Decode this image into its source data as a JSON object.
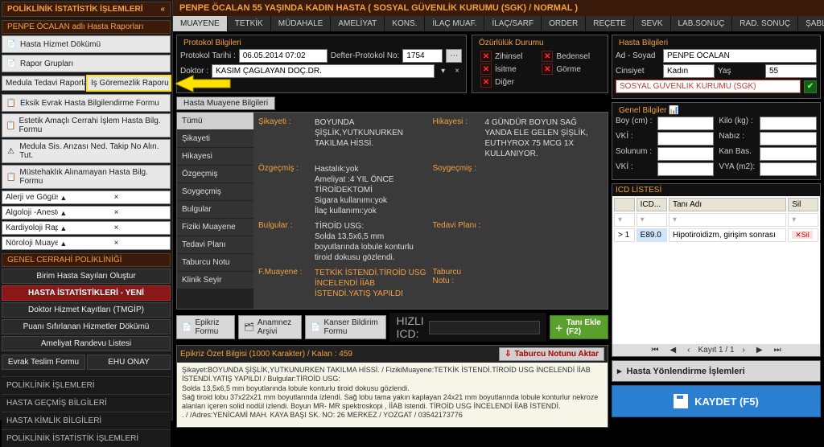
{
  "left": {
    "title": "POLİKLİNİK İSTATİSTİK İŞLEMLERİ",
    "collapse": "«",
    "section1": "PENPE ÖCALAN adlı Hasta Raporları",
    "btn_hasta_hizmet": "Hasta Hizmet Dökümü",
    "btn_rapor_gruplari": "Rapor Grupları",
    "btn_medula": "Medula Tedavi Raporları",
    "btn_is_goremezlik": "Iş Göremezlik Raporu",
    "btn_eksik_evrak": "Eksik Evrak Hasta Bilgilendirme Formu",
    "btn_estetik": "Estetik Amaçlı Cerrahi İşlem Hasta Bilg. Formu",
    "btn_medula_ariza": "Medula Sis. Arızası Ned. Takip No Alın. Tut.",
    "btn_mustehak": "Müstehaklık Alınamayan Hasta Bilg. Formu",
    "combo1": "Alerji ve Gögüs Hastalıkları (Prick) Testleri",
    "combo2": "Algoloji -Anestezi Polikliniği Formları",
    "combo3": "Kardiyoloji Raporları",
    "combo4": "Nöroloji Muayene Testleri",
    "section2": "GENEL CERRAHİ POLİKLİNİĞİ",
    "btn_birim": "Birim Hasta Sayıları Oluştur",
    "btn_istat": "HASTA İSTATİSTİKLERİ - YENİ",
    "btn_doktor": "Doktor Hizmet Kayıtları (TMGİP)",
    "btn_puanisifir": "Puanı Sıfırlanan Hizmetler Dökümü",
    "btn_ameliyat": "Ameliyat Randevu Listesi",
    "btn_evrak": "Evrak Teslim Formu",
    "btn_ehu": "EHU ONAY",
    "nav1": "POLİKLİNİK İŞLEMLERİ",
    "nav2": "HASTA GEÇMİŞ BİLGİLERİ",
    "nav3": "HASTA KİMLİK BİLGİLERİ",
    "nav4": "POLİKLİNİK İSTATİSTİK İŞLEMLERİ"
  },
  "top": {
    "banner": "PENPE ÖCALAN 55 YAŞINDA KADIN HASTA ( SOSYAL GÜVENLİK KURUMU (SGK) / NORMAL )",
    "tabs": [
      "MUAYENE",
      "TETKİK",
      "MÜDAHALE",
      "AMELİYAT",
      "KONS.",
      "İLAÇ MUAF.",
      "İLAÇ/SARF",
      "ORDER",
      "REÇETE",
      "SEVK",
      "LAB.SONUÇ",
      "RAD. SONUÇ",
      "ŞABLON"
    ]
  },
  "protokol": {
    "title": "Protokol Bilgileri",
    "tarih_label": "Protokol Tarihi :",
    "tarih": "06.05.2014 07:02",
    "defter_label": "Defter-Protokol No:",
    "defter": "1754",
    "doktor_label": "Doktor :",
    "doktor": "KASIM ÇAĞLAYAN DOÇ.DR."
  },
  "ozurluluk": {
    "title": "Özürlülük Durumu",
    "items": [
      "Zihinsel",
      "Bedensel",
      "İsitme",
      "Görme",
      "Diğer"
    ]
  },
  "hasta": {
    "title": "Hasta Bilgileri",
    "ad_label": "Ad - Soyad",
    "ad": "PENPE ÖCALAN",
    "cins_label": "Cinsiyet",
    "cins": "Kadın",
    "yas_label": "Yaş",
    "yas": "55",
    "kurum": "SOSYAL GÜVENLİK KURUMU (SGK)"
  },
  "muayene": {
    "title": "Hasta Muayene Bilgileri",
    "tabs": [
      "Tümü",
      "Şikayeti",
      "Hikayesi",
      "Özgeçmiş",
      "Soygeçmiş",
      "Bulgular",
      "Fiziki Muayene",
      "Tedavi Planı",
      "Taburcu Notu",
      "Klinik Seyir"
    ],
    "l_sikayeti": "Şikayeti :",
    "v_sikayeti": "BOYUNDA ŞİŞLİK,YUTKUNURKEN TAKILMA HİSSİ.",
    "l_hikayesi": "Hikayesi :",
    "v_hikayesi": "4 GÜNDÜR BOYUN SAĞ YANDA ELE GELEN ŞİŞLİK, EUTHYROX 75 MCG 1X KULLANIYOR.",
    "l_ozgecmis": "Özgeçmiş :",
    "v_ozgecmis": "Hastalık:yok\nAmeliyat :4 YIL ÖNCE TİROİDEKTOMİ\nSigara kullanımı:yok\nİlaç kullanımı:yok",
    "l_soygecmis": "Soygeçmiş :",
    "l_bulgular": "Bulgular :",
    "v_bulgular": "TİROİD USG:\nSolda 13,5x6,5 mm boyutlarında lobule konturlu tiroid dokusu gözlendi.",
    "l_tedavi": "Tedavi Planı :",
    "l_fmuayene": "F.Muayene :",
    "v_fmuayene": "TETKİK İSTENDİ.TİROİD USG İNCELENDİ İİAB İSTENDİ.YATIŞ YAPILDI",
    "l_taburcu": "Taburcu\nNotu :"
  },
  "btns": {
    "epikriz": "Epikriz Formu",
    "anamnez": "Anamnez Arşivi",
    "kanser": "Kanser Bildirim Formu",
    "hizli": "HIZLI ICD:",
    "tani": "Tanı Ekle (F2)"
  },
  "epikriz": {
    "title": "Epikriz Özet Bilgisi (1000 Karakter) / Kalan : 459",
    "aktar": "Taburcu Notunu Aktar",
    "body": "Şikayet:BOYUNDA ŞİŞLİK,YUTKUNURKEN TAKILMA HİSSİ. / FizikiMuayene:TETKİK İSTENDİ.TİROİD USG İNCELENDİ İİAB İSTENDİ.YATIŞ YAPILDI / Bulgular:TİROİD USG:\nSolda 13,5x6,5 mm boyutlarında lobule konturlu tiroid dokusu gözlendi.\nSağ tiroid lobu 37x22x21 mm boyutlarında izlendi. Sağ lobu tama yakın kaplayan 24x21 mm boyutlarında lobule konturlur nekroze alanları içeren solid nodül izlendi. Boyun MR- MR spektroskopi , İİAB istendi. TİROİD USG İNCELENDİ İİAB İSTENDİ.\n. / /Adres:YENİCAMİ MAH. KAYA BAŞI SK.  NO: 26 MERKEZ / YOZGAT / 03542173776"
  },
  "genel": {
    "title": "Genel Bilgiler",
    "boy": "Boy (cm) :",
    "kilo": "Kilo (kg) :",
    "vki": "VKİ :",
    "nabiz": "Nabız :",
    "solunum": "Solunum :",
    "kanbas": "Kan Bas.",
    "vki2": "VKİ :",
    "vya": "VYA (m2):"
  },
  "icd": {
    "title": "ICD LİSTESİ",
    "cols": [
      "",
      "ICD...",
      "Tanı Adı",
      "Sil"
    ],
    "rows": [
      {
        "idx": "> 1",
        "code": "E89.0",
        "name": "Hipotiroidizm, girişim sonrası",
        "sil": "Sil"
      }
    ],
    "pager": "Kayıt 1 / 1"
  },
  "yonlendir": "Hasta Yönlendirme İşlemleri",
  "kaydet": "KAYDET (F5)"
}
